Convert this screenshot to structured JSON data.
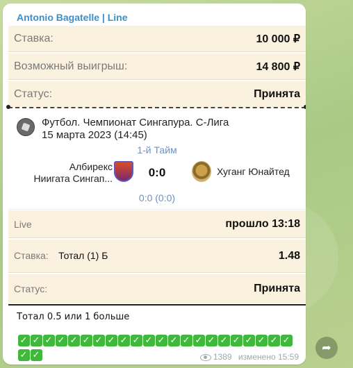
{
  "message": {
    "sender": "Antonio Bagatelle | Line",
    "top_rows": [
      {
        "label": "Ставка:",
        "value": "10 000 ₽"
      },
      {
        "label": "Возможный выигрыш:",
        "value": "14 800 ₽"
      },
      {
        "label": "Статус:",
        "value": "Принята"
      }
    ],
    "match": {
      "league": "Футбол. Чемпионат Сингапура. С-Лига",
      "date": "15 марта 2023 (14:45)",
      "period": "1-й Тайм",
      "team1_line1": "Албирекс",
      "team1_line2": "Ниигата Сингап...",
      "score": "0:0",
      "team2": "Хуганг Юнайтед",
      "half_score": "0:0 (0:0)"
    },
    "live_row": {
      "label": "Live",
      "value": "прошло 13:18"
    },
    "bet_row": {
      "label": "Ставка:",
      "detail": "Тотал (1) Б",
      "value": "1.48"
    },
    "status_row": {
      "label": "Статус:",
      "value": "Принята"
    },
    "caption": "Тотал 0.5 или 1 больше",
    "checkmark_count": 24,
    "views": "1389",
    "edited_time": "изменено 15:59"
  }
}
